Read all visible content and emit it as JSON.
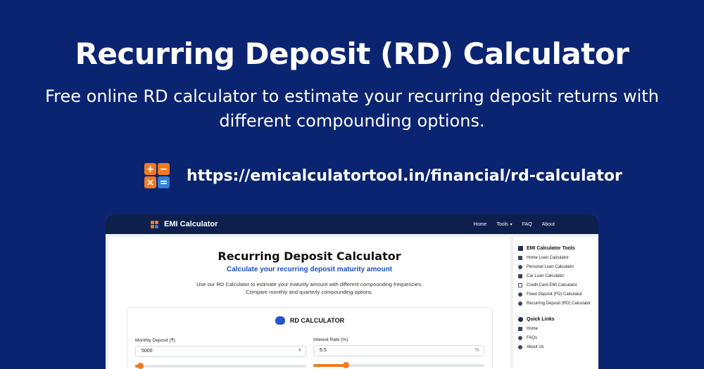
{
  "hero": {
    "title": "Recurring Deposit (RD) Calculator",
    "subtitle": "Free online RD calculator to estimate your recurring deposit returns with different compounding options.",
    "url": "https://emicalculatortool.in/financial/rd-calculator",
    "logo_glyphs": [
      "+",
      "−",
      "×",
      "="
    ]
  },
  "colors": {
    "background": "#0b2472",
    "accent_orange": "#f07a22",
    "accent_blue": "#1d4fc4",
    "nav_dark": "#0d1f4d"
  },
  "site": {
    "brand": "EMI Calculator",
    "nav": {
      "home": "Home",
      "tools": "Tools",
      "tools_chevron": "▾",
      "faq": "FAQ",
      "about": "About"
    },
    "main": {
      "title": "Recurring Deposit Calculator",
      "subtitle": "Calculate your recurring deposit maturity amount",
      "description": "Use our RD Calculator to estimate your maturity amount with different compounding frequencies. Compare monthly and quarterly compounding options.",
      "card_title": "RD CALCULATOR",
      "card_icon": "piggy-bank-icon",
      "fields": {
        "monthly_deposit": {
          "label": "Monthly Deposit (₹)",
          "value": "5000",
          "suffix": "₹",
          "slider_fraction": 0.03
        },
        "interest_rate": {
          "label": "Interest Rate (%)",
          "value": "6.5",
          "suffix": "%",
          "slider_fraction": 0.19
        }
      }
    },
    "sidebar": {
      "tools_heading": "EMI Calculator Tools",
      "tools": [
        {
          "label": "Home Loan Calculator",
          "icon": "home-icon"
        },
        {
          "label": "Personal Loan Calculator",
          "icon": "user-icon"
        },
        {
          "label": "Car Loan Calculator",
          "icon": "car-icon"
        },
        {
          "label": "Credit Card EMI Calculator",
          "icon": "credit-card-icon"
        },
        {
          "label": "Fixed Deposit (FD) Calculator",
          "icon": "piggy-bank-icon"
        },
        {
          "label": "Recurring Deposit (RD) Calculator",
          "icon": "piggy-bank-icon"
        }
      ],
      "quick_heading": "Quick Links",
      "quick": [
        {
          "label": "Home",
          "icon": "home-icon"
        },
        {
          "label": "FAQs",
          "icon": "question-icon"
        },
        {
          "label": "About Us",
          "icon": "info-icon"
        }
      ]
    }
  }
}
